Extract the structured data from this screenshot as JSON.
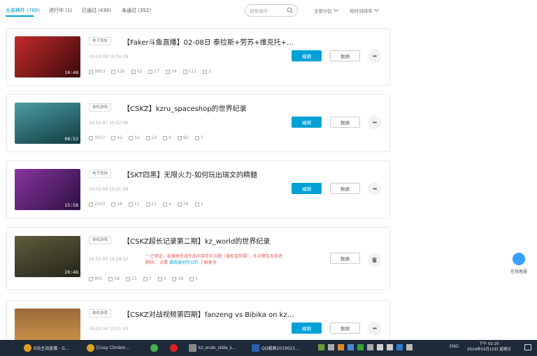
{
  "filter_tabs": [
    {
      "label": "全部稿件 (788)",
      "active": true
    },
    {
      "label": "进行中 (1)",
      "active": false
    },
    {
      "label": "已通过 (436)",
      "active": false
    },
    {
      "label": "未通过 (352)",
      "active": false
    }
  ],
  "search": {
    "placeholder": "搜索稿件"
  },
  "dropdowns": {
    "partition": "全部分区",
    "sort": "按时间排序"
  },
  "videos": [
    {
      "category": "电子竞技",
      "title": "【Faker斗鱼直播】02-08日 泰拉斯+劳苏+维克托+…",
      "date": "19-02-09 10:34:28",
      "duration": "10:48",
      "stats": {
        "play": "3853",
        "danmaku": "126",
        "reply": "62",
        "coin": "57",
        "fav": "34",
        "like": "111",
        "share": "3"
      },
      "edit_label": "编辑",
      "data_label": "数据",
      "more_label": "•••",
      "thumb_colors": [
        "#b11d1d",
        "#2a0a0a"
      ]
    },
    {
      "category": "单机游戏",
      "title": "【CSKZ】kzru_spaceshop的世界纪录",
      "date": "19-02-07 10:52:06",
      "duration": "08:52",
      "stats": {
        "play": "3017",
        "danmaku": "42",
        "reply": "32",
        "coin": "24",
        "fav": "6",
        "like": "60",
        "share": "3"
      },
      "edit_label": "编辑",
      "data_label": "数据",
      "more_label": "•••",
      "thumb_colors": [
        "#3f8f93",
        "#16424a"
      ]
    },
    {
      "category": "电子竞技",
      "title": "【SKT四黑】无限火力-如何玩出瑞文的精髓",
      "date": "19-02-06 10:41:58",
      "duration": "15:58",
      "stats": {
        "play": "2043",
        "danmaku": "18",
        "reply": "11",
        "coin": "11",
        "fav": "4",
        "like": "58",
        "share": "1"
      },
      "edit_label": "编辑",
      "data_label": "数据",
      "more_label": "•••",
      "thumb_colors": [
        "#7a2a8f",
        "#2a1040"
      ]
    },
    {
      "category": "单机游戏",
      "title": "【CSKZ超长记录第二期】kz_world的世界纪录",
      "date": "19-02-05 16:29:12",
      "duration": "20:48",
      "stats": {
        "play": "901",
        "danmaku": "58",
        "reply": "23",
        "coin": "7",
        "fav": "3",
        "like": "38",
        "share": "1"
      },
      "warning_main": "^ 已锁定，投稿类型或作品内容存在问题（侵权或剪辑），多次警告无效将",
      "warning_tail": "删除。 详情",
      "warning_link": "请阅读创作公约",
      "warning_end": "了解更多",
      "data_label": "数据",
      "thumb_colors": [
        "#5b5a3a",
        "#2a2b1b"
      ]
    },
    {
      "category": "单机游戏",
      "title": "【CSKZ对战视频第四期】fanzeng vs Bibika on kz…",
      "date": "19-02-04 10:21:03",
      "duration": "",
      "stats": {
        "play": "",
        "danmaku": "",
        "reply": "",
        "coin": "",
        "fav": "",
        "like": "",
        "share": ""
      },
      "edit_label": "编辑",
      "data_label": "数据",
      "more_label": "•••",
      "thumb_colors": [
        "#c98a3a",
        "#6a4020"
      ]
    }
  ],
  "service": {
    "label": "在线客服"
  },
  "taskbar": {
    "items": [
      {
        "label": "B站主站直播 - G…",
        "icon": "chrome-icon",
        "color": "#e0a020"
      },
      {
        "label": "[Cosy Climbin…",
        "icon": "chrome-icon",
        "color": "#e0a020"
      },
      {
        "label": "",
        "icon": "app-green-icon",
        "color": "#4cae4c"
      },
      {
        "label": "",
        "icon": "app-red-icon",
        "color": "#e02020"
      },
      {
        "label": "kz_ondo_slide_s…",
        "icon": "game-icon",
        "color": "#888888"
      },
      {
        "label": "QQ截图2019021…",
        "icon": "photoshop-icon",
        "color": "#2a5fa8"
      }
    ],
    "lang": "ENG",
    "time": "02:20",
    "date": "2019年02月10日 星期日",
    "time_prefix": "下午"
  },
  "colors": {
    "accent": "#00a1d6",
    "warning": "#e85a5a",
    "taskbar": "#1e2a3a"
  }
}
